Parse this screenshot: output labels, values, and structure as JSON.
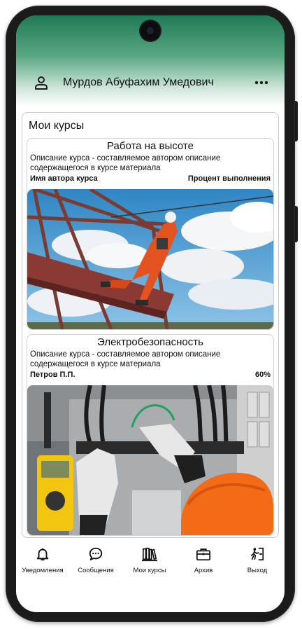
{
  "header": {
    "user_name": "Мурдов Абуфахим Умедович",
    "user_icon": "user-icon",
    "more_icon": "more-icon"
  },
  "courses_panel": {
    "title": "Мои курсы",
    "courses": [
      {
        "title": "Работа на высоте",
        "description": "Описание курса - составляемое автором описание содержащегося в курсе материала",
        "author": "Имя автора курса",
        "progress": "Процент выполнения",
        "image": "worker-at-height-photo"
      },
      {
        "title": "Электробезопасность",
        "description": "Описание курса - составляемое автором описание содержащегося в курсе материала",
        "author": "Петров П.П.",
        "progress": "60%",
        "image": "electrical-safety-photo"
      }
    ]
  },
  "nav": [
    {
      "label": "Уведомления",
      "icon": "bell-icon"
    },
    {
      "label": "Сообщения",
      "icon": "chat-bubble-icon"
    },
    {
      "label": "Мои курсы",
      "icon": "books-icon"
    },
    {
      "label": "Архив",
      "icon": "briefcase-icon"
    },
    {
      "label": "Выход",
      "icon": "exit-icon"
    }
  ],
  "colors": {
    "accent_green": "#1f7a55",
    "text": "#111111",
    "border": "#c9c9c9"
  }
}
